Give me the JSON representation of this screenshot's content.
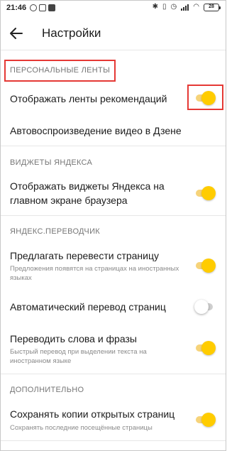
{
  "status_bar": {
    "time": "21:46",
    "battery": "28"
  },
  "header": {
    "title": "Настройки"
  },
  "sections": [
    {
      "header": "ПЕРСОНАЛЬНЫЕ ЛЕНТЫ",
      "items": [
        {
          "title": "Отображать ленты рекомендаций",
          "toggle": "on"
        },
        {
          "title": "Автовоспроизведение видео в Дзене"
        }
      ]
    },
    {
      "header": "ВИДЖЕТЫ ЯНДЕКСА",
      "items": [
        {
          "title_line1": "Отображать виджеты Яндекса на",
          "title_line2": "главном экране браузера",
          "toggle": "on"
        }
      ]
    },
    {
      "header": "ЯНДЕКС.ПЕРЕВОДЧИК",
      "items": [
        {
          "title": "Предлагать перевести страницу",
          "subtitle_line1": "Предложения появятся на страницах на иностранных",
          "subtitle_line2": "языках",
          "toggle": "on"
        },
        {
          "title": "Автоматический перевод страниц",
          "toggle": "off"
        },
        {
          "title": "Переводить слова и фразы",
          "subtitle_line1": "Быстрый перевод при выделении текста на",
          "subtitle_line2": "иностранном языке",
          "toggle": "on"
        }
      ]
    },
    {
      "header": "ДОПОЛНИТЕЛЬНО",
      "items": [
        {
          "title": "Сохранять копии открытых страниц",
          "subtitle": "Сохранять последние посещённые страницы",
          "toggle": "on"
        }
      ]
    }
  ],
  "colors": {
    "accent": "#ffcc00",
    "highlight": "#e53935"
  }
}
